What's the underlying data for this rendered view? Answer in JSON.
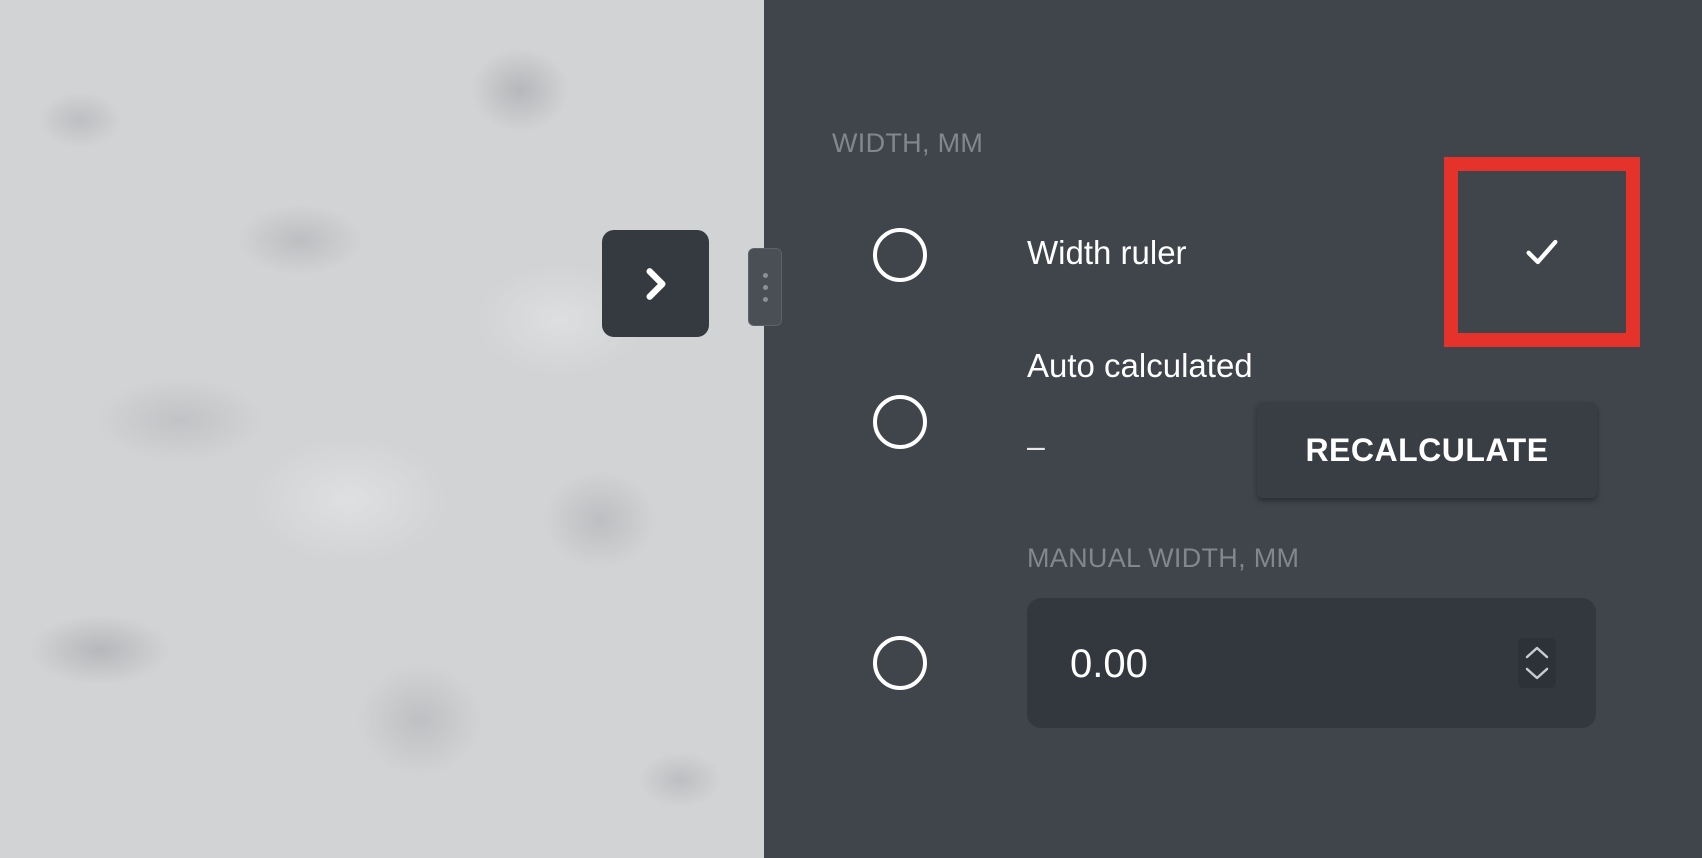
{
  "viewer": {
    "toggle_icon": "chevron-right-icon",
    "handle_icon": "drag-handle-icon"
  },
  "panel": {
    "section_label": "WIDTH, MM",
    "options": {
      "width_ruler": {
        "label": "Width ruler",
        "selected": false
      },
      "auto_calculated": {
        "label": "Auto calculated",
        "value": "–",
        "selected": false,
        "button_label": "RECALCULATE"
      },
      "manual": {
        "label": "MANUAL WIDTH, MM",
        "value": "0.00",
        "selected": false
      }
    },
    "confirm_icon": "checkmark-icon"
  },
  "colors": {
    "panel_bg": "#40454c",
    "highlight": "#e5322a",
    "input_bg": "#33383f"
  }
}
